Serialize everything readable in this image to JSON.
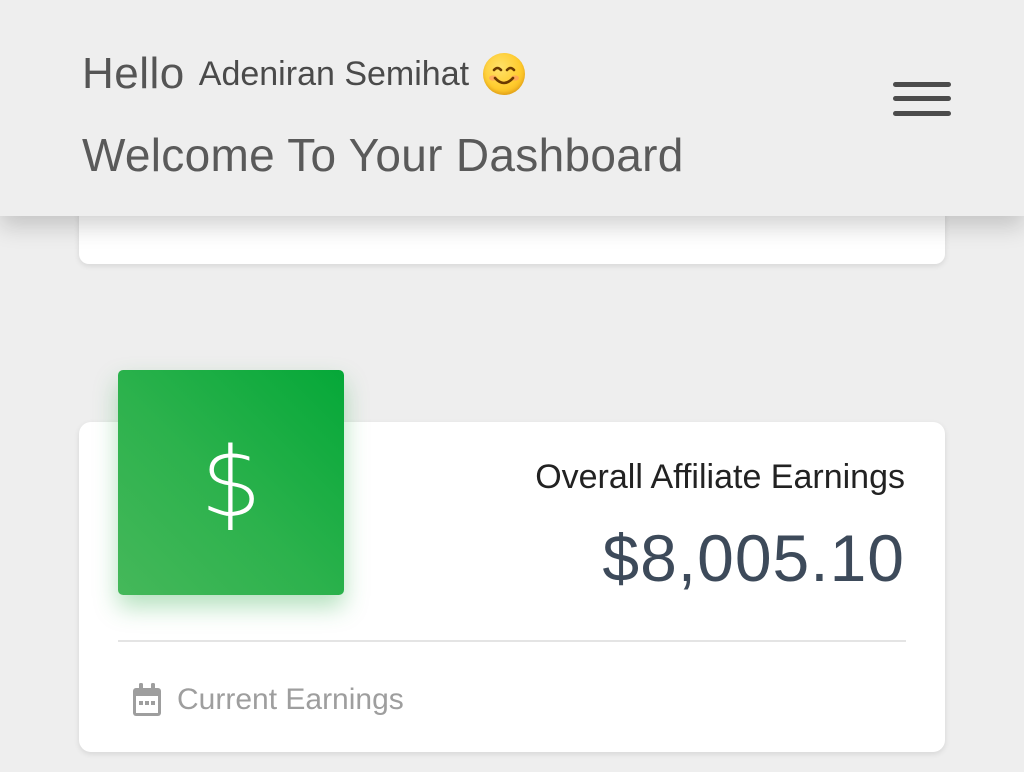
{
  "header": {
    "greeting": "Hello",
    "user_name": "Adeniran Semihat",
    "welcome": "Welcome To Your Dashboard",
    "emoji_icon": "smiling-face-icon",
    "menu_icon": "hamburger-menu-icon"
  },
  "earnings_card": {
    "icon": "dollar-icon",
    "title": "Overall Affiliate Earnings",
    "value": "$8,005.10",
    "footer_icon": "calendar-icon",
    "footer_label": "Current Earnings"
  },
  "colors": {
    "background": "#eeeeee",
    "accent_green": "#2db24d",
    "value_text": "#3d4a5a",
    "muted_text": "#9e9e9e"
  }
}
